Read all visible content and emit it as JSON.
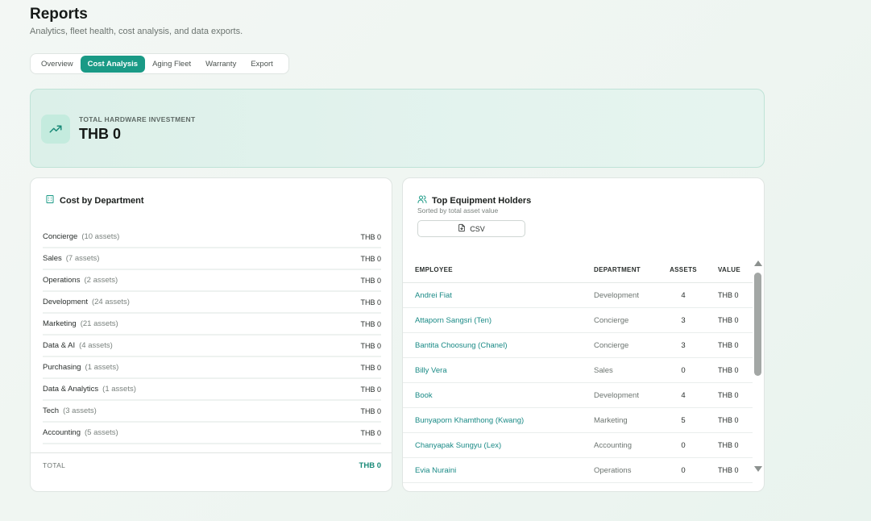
{
  "page": {
    "title": "Reports",
    "subtitle": "Analytics, fleet health, cost analysis, and data exports."
  },
  "tabs": [
    {
      "label": "Overview",
      "active": false
    },
    {
      "label": "Cost Analysis",
      "active": true
    },
    {
      "label": "Aging Fleet",
      "active": false
    },
    {
      "label": "Warranty",
      "active": false
    },
    {
      "label": "Export",
      "active": false
    }
  ],
  "hero": {
    "label": "TOTAL HARDWARE INVESTMENT",
    "value": "THB 0",
    "icon": "trending-up-icon"
  },
  "cost_by_department": {
    "title": "Cost by Department",
    "icon": "building-icon",
    "rows": [
      {
        "name": "Concierge",
        "count": "(10 assets)",
        "value": "THB 0"
      },
      {
        "name": "Sales",
        "count": "(7 assets)",
        "value": "THB 0"
      },
      {
        "name": "Operations",
        "count": "(2 assets)",
        "value": "THB 0"
      },
      {
        "name": "Development",
        "count": "(24 assets)",
        "value": "THB 0"
      },
      {
        "name": "Marketing",
        "count": "(21 assets)",
        "value": "THB 0"
      },
      {
        "name": "Data & AI",
        "count": "(4 assets)",
        "value": "THB 0"
      },
      {
        "name": "Purchasing",
        "count": "(1 assets)",
        "value": "THB 0"
      },
      {
        "name": "Data & Analytics",
        "count": "(1 assets)",
        "value": "THB 0"
      },
      {
        "name": "Tech",
        "count": "(3 assets)",
        "value": "THB 0"
      },
      {
        "name": "Accounting",
        "count": "(5 assets)",
        "value": "THB 0"
      }
    ],
    "total_label": "TOTAL",
    "total_value": "THB 0"
  },
  "top_holders": {
    "title": "Top Equipment Holders",
    "subtitle": "Sorted by total asset value",
    "icon": "users-icon",
    "csv_label": "CSV",
    "columns": {
      "employee": "EMPLOYEE",
      "department": "DEPARTMENT",
      "assets": "ASSETS",
      "value": "VALUE"
    },
    "rows": [
      {
        "employee": "Andrei Fiat",
        "department": "Development",
        "assets": "4",
        "value": "THB 0"
      },
      {
        "employee": "Attaporn Sangsri (Ten)",
        "department": "Concierge",
        "assets": "3",
        "value": "THB 0"
      },
      {
        "employee": "Bantita Choosung (Chanel)",
        "department": "Concierge",
        "assets": "3",
        "value": "THB 0"
      },
      {
        "employee": "Billy Vera",
        "department": "Sales",
        "assets": "0",
        "value": "THB 0"
      },
      {
        "employee": "Book",
        "department": "Development",
        "assets": "4",
        "value": "THB 0"
      },
      {
        "employee": "Bunyaporn Khamthong (Kwang)",
        "department": "Marketing",
        "assets": "5",
        "value": "THB 0"
      },
      {
        "employee": "Chanyapak Sungyu (Lex)",
        "department": "Accounting",
        "assets": "0",
        "value": "THB 0"
      },
      {
        "employee": "Evia Nuraini",
        "department": "Operations",
        "assets": "0",
        "value": "THB 0"
      }
    ]
  },
  "colors": {
    "accent": "#1a9a86",
    "link": "#1a8a86",
    "hero_bg": "#dcf0e9"
  }
}
